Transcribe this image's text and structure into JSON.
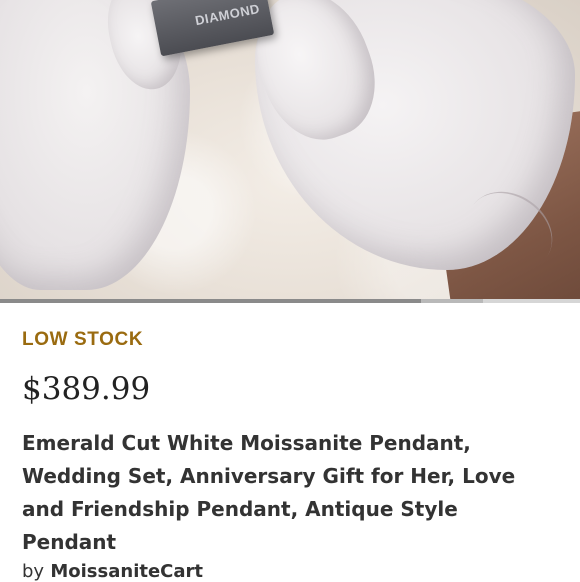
{
  "product_image": {
    "box_label": "DIAMOND",
    "gallery_progress": 0.78
  },
  "listing": {
    "stock_status": "LOW STOCK",
    "price": "$389.99",
    "title": "Emerald Cut White Moissanite Pendant, Wedding Set, Anniversary Gift for Her, Love and Friendship Pendant, Antique Style Pendant",
    "seller_prefix": "by",
    "seller_name": "MoissaniteCart"
  },
  "colors": {
    "stock_status": "#9a6b10",
    "text": "#222222"
  }
}
